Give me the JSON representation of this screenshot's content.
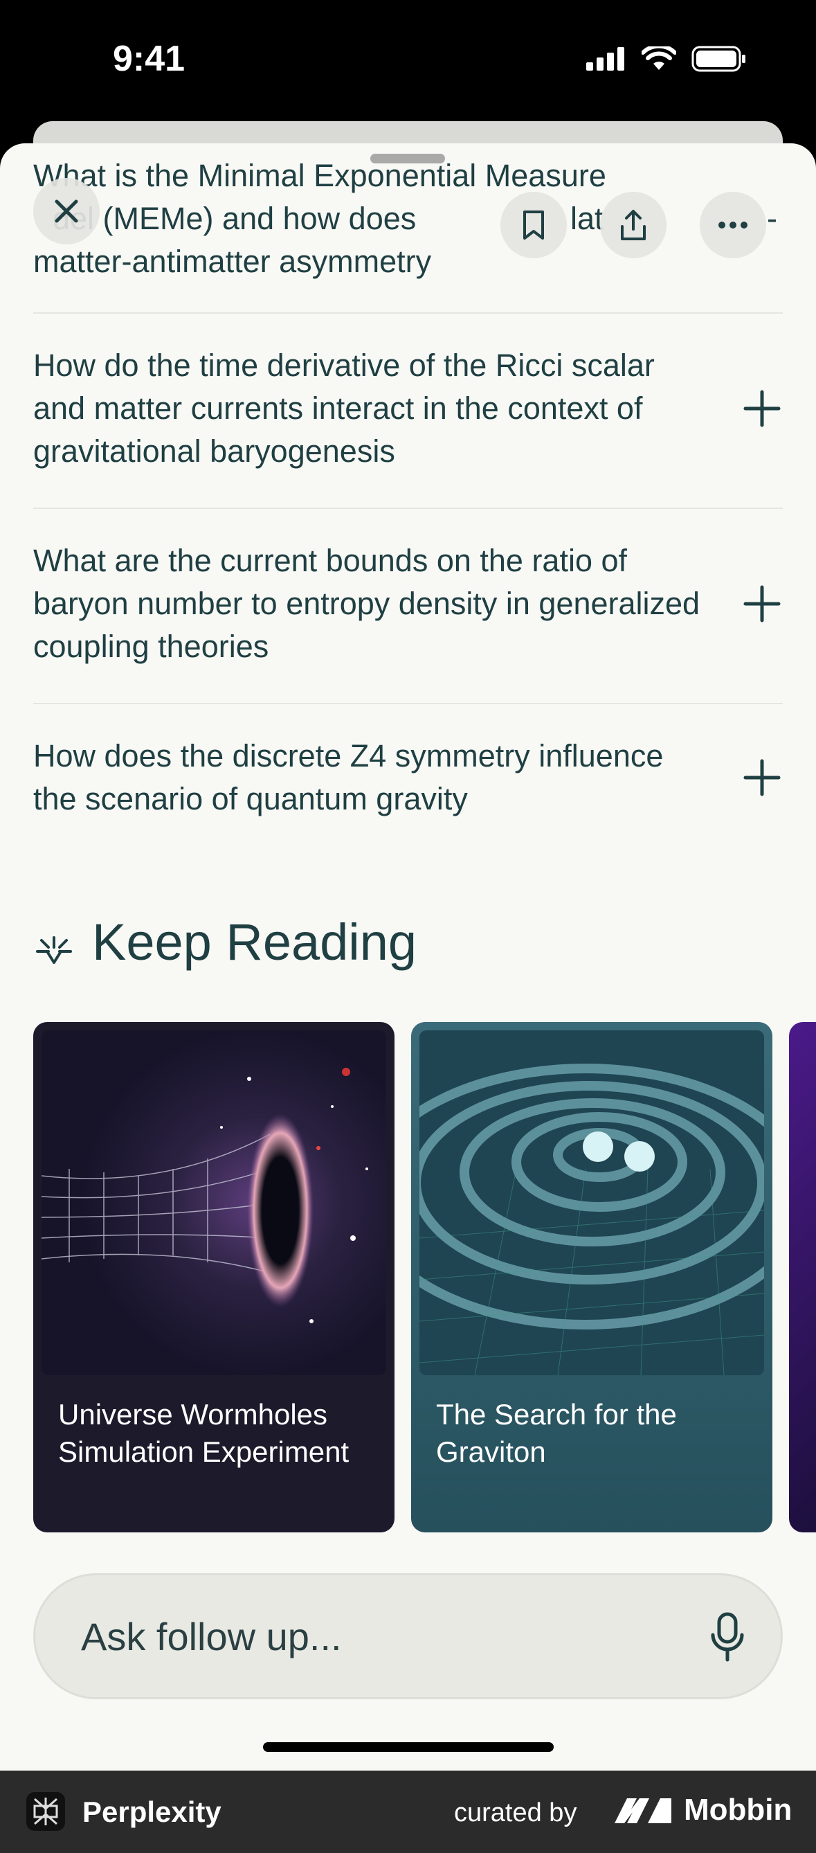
{
  "status": {
    "time": "9:41"
  },
  "questions": [
    {
      "text": "What is the Minimal Exponential Measure Model (MEMe) and how does it relate to matter-antimatter asymmetry"
    },
    {
      "text": "How do the time derivative of the Ricci scalar and matter currents interact in the context of gravitational baryogenesis"
    },
    {
      "text": "What are the current bounds on the ratio of baryon number to entropy density in generalized coupling theories"
    },
    {
      "text": "How does the discrete Z4 symmetry influence the scenario of quantum gravity"
    }
  ],
  "top_question_visible": {
    "line1": "What is the Minimal Exponential Measure",
    "line2_left": "del (MEMe) and how does",
    "line2_mid": "lat",
    "line2_right": "-",
    "line3": "matter-antimatter asymmetry"
  },
  "keep_reading": {
    "title": "Keep Reading",
    "cards": [
      {
        "title": "Universe Wormholes Simulation Experiment",
        "bg": "#1d1a2b"
      },
      {
        "title": "The Search for the Graviton",
        "bg": "#2f5d69"
      }
    ]
  },
  "ask": {
    "placeholder": "Ask follow up..."
  },
  "footer": {
    "app_name": "Perplexity",
    "curated_by": "curated by",
    "brand": "Mobbin"
  },
  "icons": {
    "close": "close-icon",
    "bookmark": "bookmark-icon",
    "share": "share-icon",
    "more": "more-icon",
    "expand": "plus-icon",
    "mic": "mic-icon",
    "keep_reading": "sparkle-icon"
  }
}
